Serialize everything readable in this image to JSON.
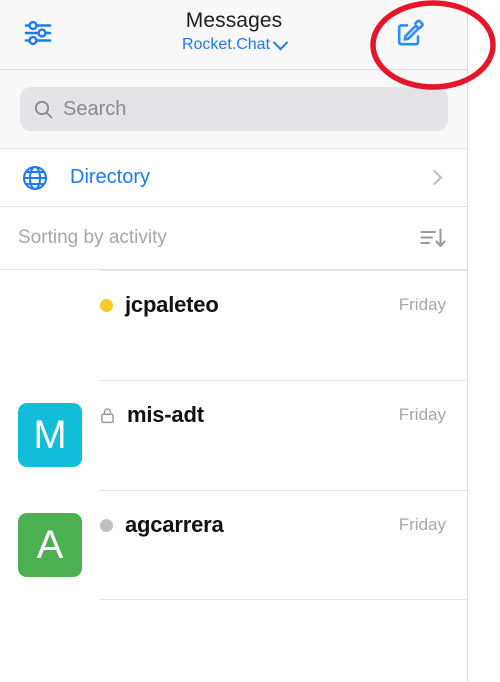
{
  "header": {
    "title": "Messages",
    "subtitle": "Rocket.Chat",
    "left_icon": "sliders-filter-icon",
    "right_icon": "compose-pencil-square-icon",
    "chevron_icon": "chevron-down-icon",
    "title_color": "#1d1d1f",
    "accent_color": "#1b7bf5",
    "background": "#f8f8f8"
  },
  "search": {
    "placeholder": "Search",
    "value": "",
    "icon": "search-icon",
    "field_background": "#e4e4e6",
    "placeholder_color": "#8a8a8e"
  },
  "directory": {
    "label": "Directory",
    "icon": "globe-icon",
    "chevron": "chevron-right-icon",
    "label_color": "#1b7bf5"
  },
  "sorting": {
    "label": "Sorting by activity",
    "icon": "sort-descending-icon",
    "label_color": "#a6a6ab"
  },
  "chats": [
    {
      "name": "jcpaleteo",
      "time": "Friday",
      "status": "away",
      "status_color": "#f6cb2b",
      "badge_icon": "status-dot-icon",
      "avatar_letter": "",
      "avatar_color": "transparent",
      "has_avatar": false
    },
    {
      "name": "mis-adt",
      "time": "Friday",
      "status": "private",
      "status_color": "#9a9aa0",
      "badge_icon": "lock-icon",
      "avatar_letter": "M",
      "avatar_color": "#11bdd8",
      "has_avatar": true
    },
    {
      "name": "agcarrera",
      "time": "Friday",
      "status": "offline",
      "status_color": "#bfbfc4",
      "badge_icon": "status-dot-icon",
      "avatar_letter": "A",
      "avatar_color": "#4caf50",
      "has_avatar": true
    }
  ],
  "annotation": {
    "shape": "red-ellipse-highlight",
    "target": "compose-pencil-square-icon",
    "color": "#e8152a"
  }
}
